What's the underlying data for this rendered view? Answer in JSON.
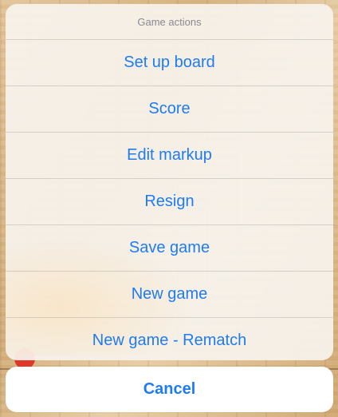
{
  "action_sheet": {
    "title": "Game actions",
    "actions": [
      {
        "label": "Set up board"
      },
      {
        "label": "Score"
      },
      {
        "label": "Edit markup"
      },
      {
        "label": "Resign"
      },
      {
        "label": "Save game"
      },
      {
        "label": "New game"
      },
      {
        "label": "New game - Rematch"
      }
    ],
    "cancel_label": "Cancel"
  },
  "colors": {
    "accent": "#1f7cf0",
    "title_text": "#8a8a8f",
    "sheet_background": "#f6f2ec",
    "board_wood": "#d9b98a",
    "stone_red": "#e0382b"
  }
}
